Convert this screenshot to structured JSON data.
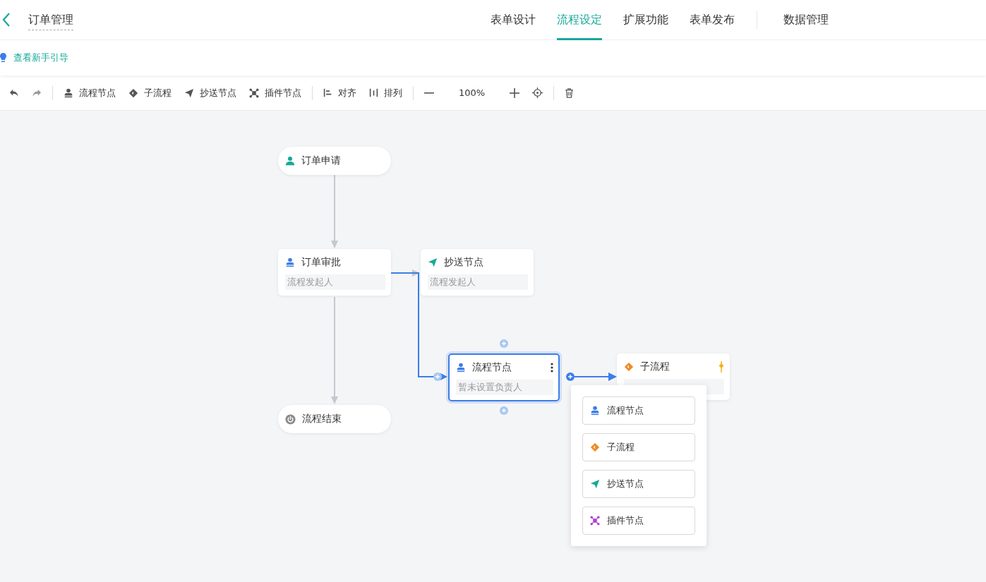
{
  "header": {
    "title": "订单管理",
    "tabs": [
      {
        "label": "表单设计",
        "selected": false
      },
      {
        "label": "流程设定",
        "selected": true
      },
      {
        "label": "扩展功能",
        "selected": false
      },
      {
        "label": "表单发布",
        "selected": false
      },
      {
        "label": "数据管理",
        "selected": false
      }
    ]
  },
  "guide_link": "查看新手引导",
  "toolbar": [
    {
      "kind": "undo"
    },
    {
      "kind": "redo"
    },
    {
      "kind": "divider"
    },
    {
      "kind": "process",
      "label": "流程节点"
    },
    {
      "kind": "subflow",
      "label": "子流程"
    },
    {
      "kind": "cc",
      "label": "抄送节点"
    },
    {
      "kind": "plugin",
      "label": "插件节点"
    },
    {
      "kind": "divider"
    },
    {
      "kind": "align",
      "label": "对齐"
    },
    {
      "kind": "arrange",
      "label": "排列"
    },
    {
      "kind": "divider"
    },
    {
      "kind": "zoom_out"
    },
    {
      "kind": "zoom_level",
      "label": "100%"
    },
    {
      "kind": "zoom_in"
    },
    {
      "kind": "locate"
    },
    {
      "kind": "divider"
    },
    {
      "kind": "delete"
    }
  ],
  "nodes": [
    {
      "kind": "start",
      "title": "订单申请",
      "selected": false
    },
    {
      "kind": "process",
      "title": "订单审批",
      "subtitle": "流程发起人",
      "selected": false
    },
    {
      "kind": "cc",
      "title": "抄送节点",
      "subtitle": "流程发起人",
      "selected": false
    },
    {
      "kind": "process",
      "title": "流程节点",
      "subtitle": "暂未设置负责人",
      "selected": true
    },
    {
      "kind": "subflow",
      "title": "子流程",
      "selected": false
    },
    {
      "kind": "end",
      "title": "流程结束",
      "selected": false
    }
  ],
  "add_menu": [
    {
      "kind": "process",
      "label": "流程节点"
    },
    {
      "kind": "subflow",
      "label": "子流程"
    },
    {
      "kind": "cc",
      "label": "抄送节点"
    },
    {
      "kind": "plugin",
      "label": "插件节点"
    }
  ]
}
